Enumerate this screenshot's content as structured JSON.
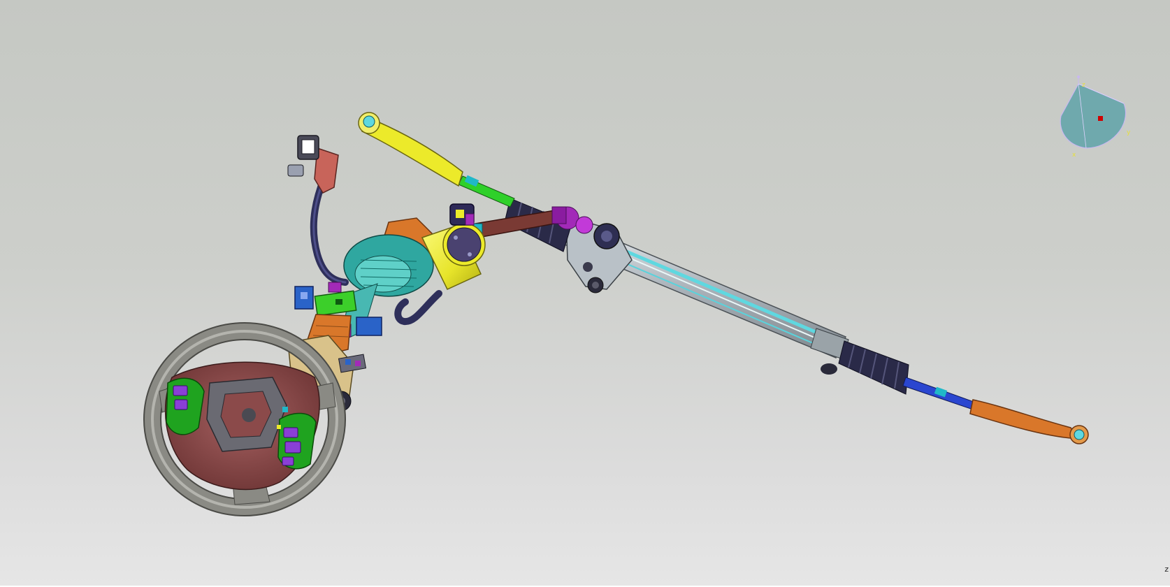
{
  "viewport": {
    "background_top": "#c5c8c3",
    "background_bottom": "#e6e6e6"
  },
  "model": {
    "parts": [
      "steering-wheel",
      "steering-column",
      "wiring-harness",
      "electric-motor",
      "intermediate-shaft",
      "steering-rack",
      "left-tie-rod",
      "right-tie-rod"
    ],
    "colors": {
      "wheel_rim": "#8a8a84",
      "wheel_hub": "#8b4a4a",
      "wheel_panels": "#1fa31f",
      "wheel_buttons": "#8a3fd6",
      "motor": "#ecea2a",
      "motor_cap": "#4a4270",
      "gear_housing": "#2fa7a0",
      "column_orange": "#d9772a",
      "shaft": "#7a3a34",
      "rack_body": "#b8c0c6",
      "rack_inner": "#5fd8e0",
      "boot": "#2a2a48",
      "tie_rod_left": "#e6e02a",
      "tie_rod_right": "#d9772a",
      "blue_part": "#2a63c8",
      "green_part": "#3ccf2a",
      "purple_part": "#a22ab8",
      "harness": "#2e2f5a",
      "connector": "#c8645a"
    }
  },
  "compass": {
    "icon": "3d-orientation-compass",
    "x_label": "x",
    "y_label": "y",
    "z_label": "z",
    "fill": "#6fa9ad",
    "marker": "#d00000"
  },
  "status": {
    "edge_glyph": "z"
  }
}
